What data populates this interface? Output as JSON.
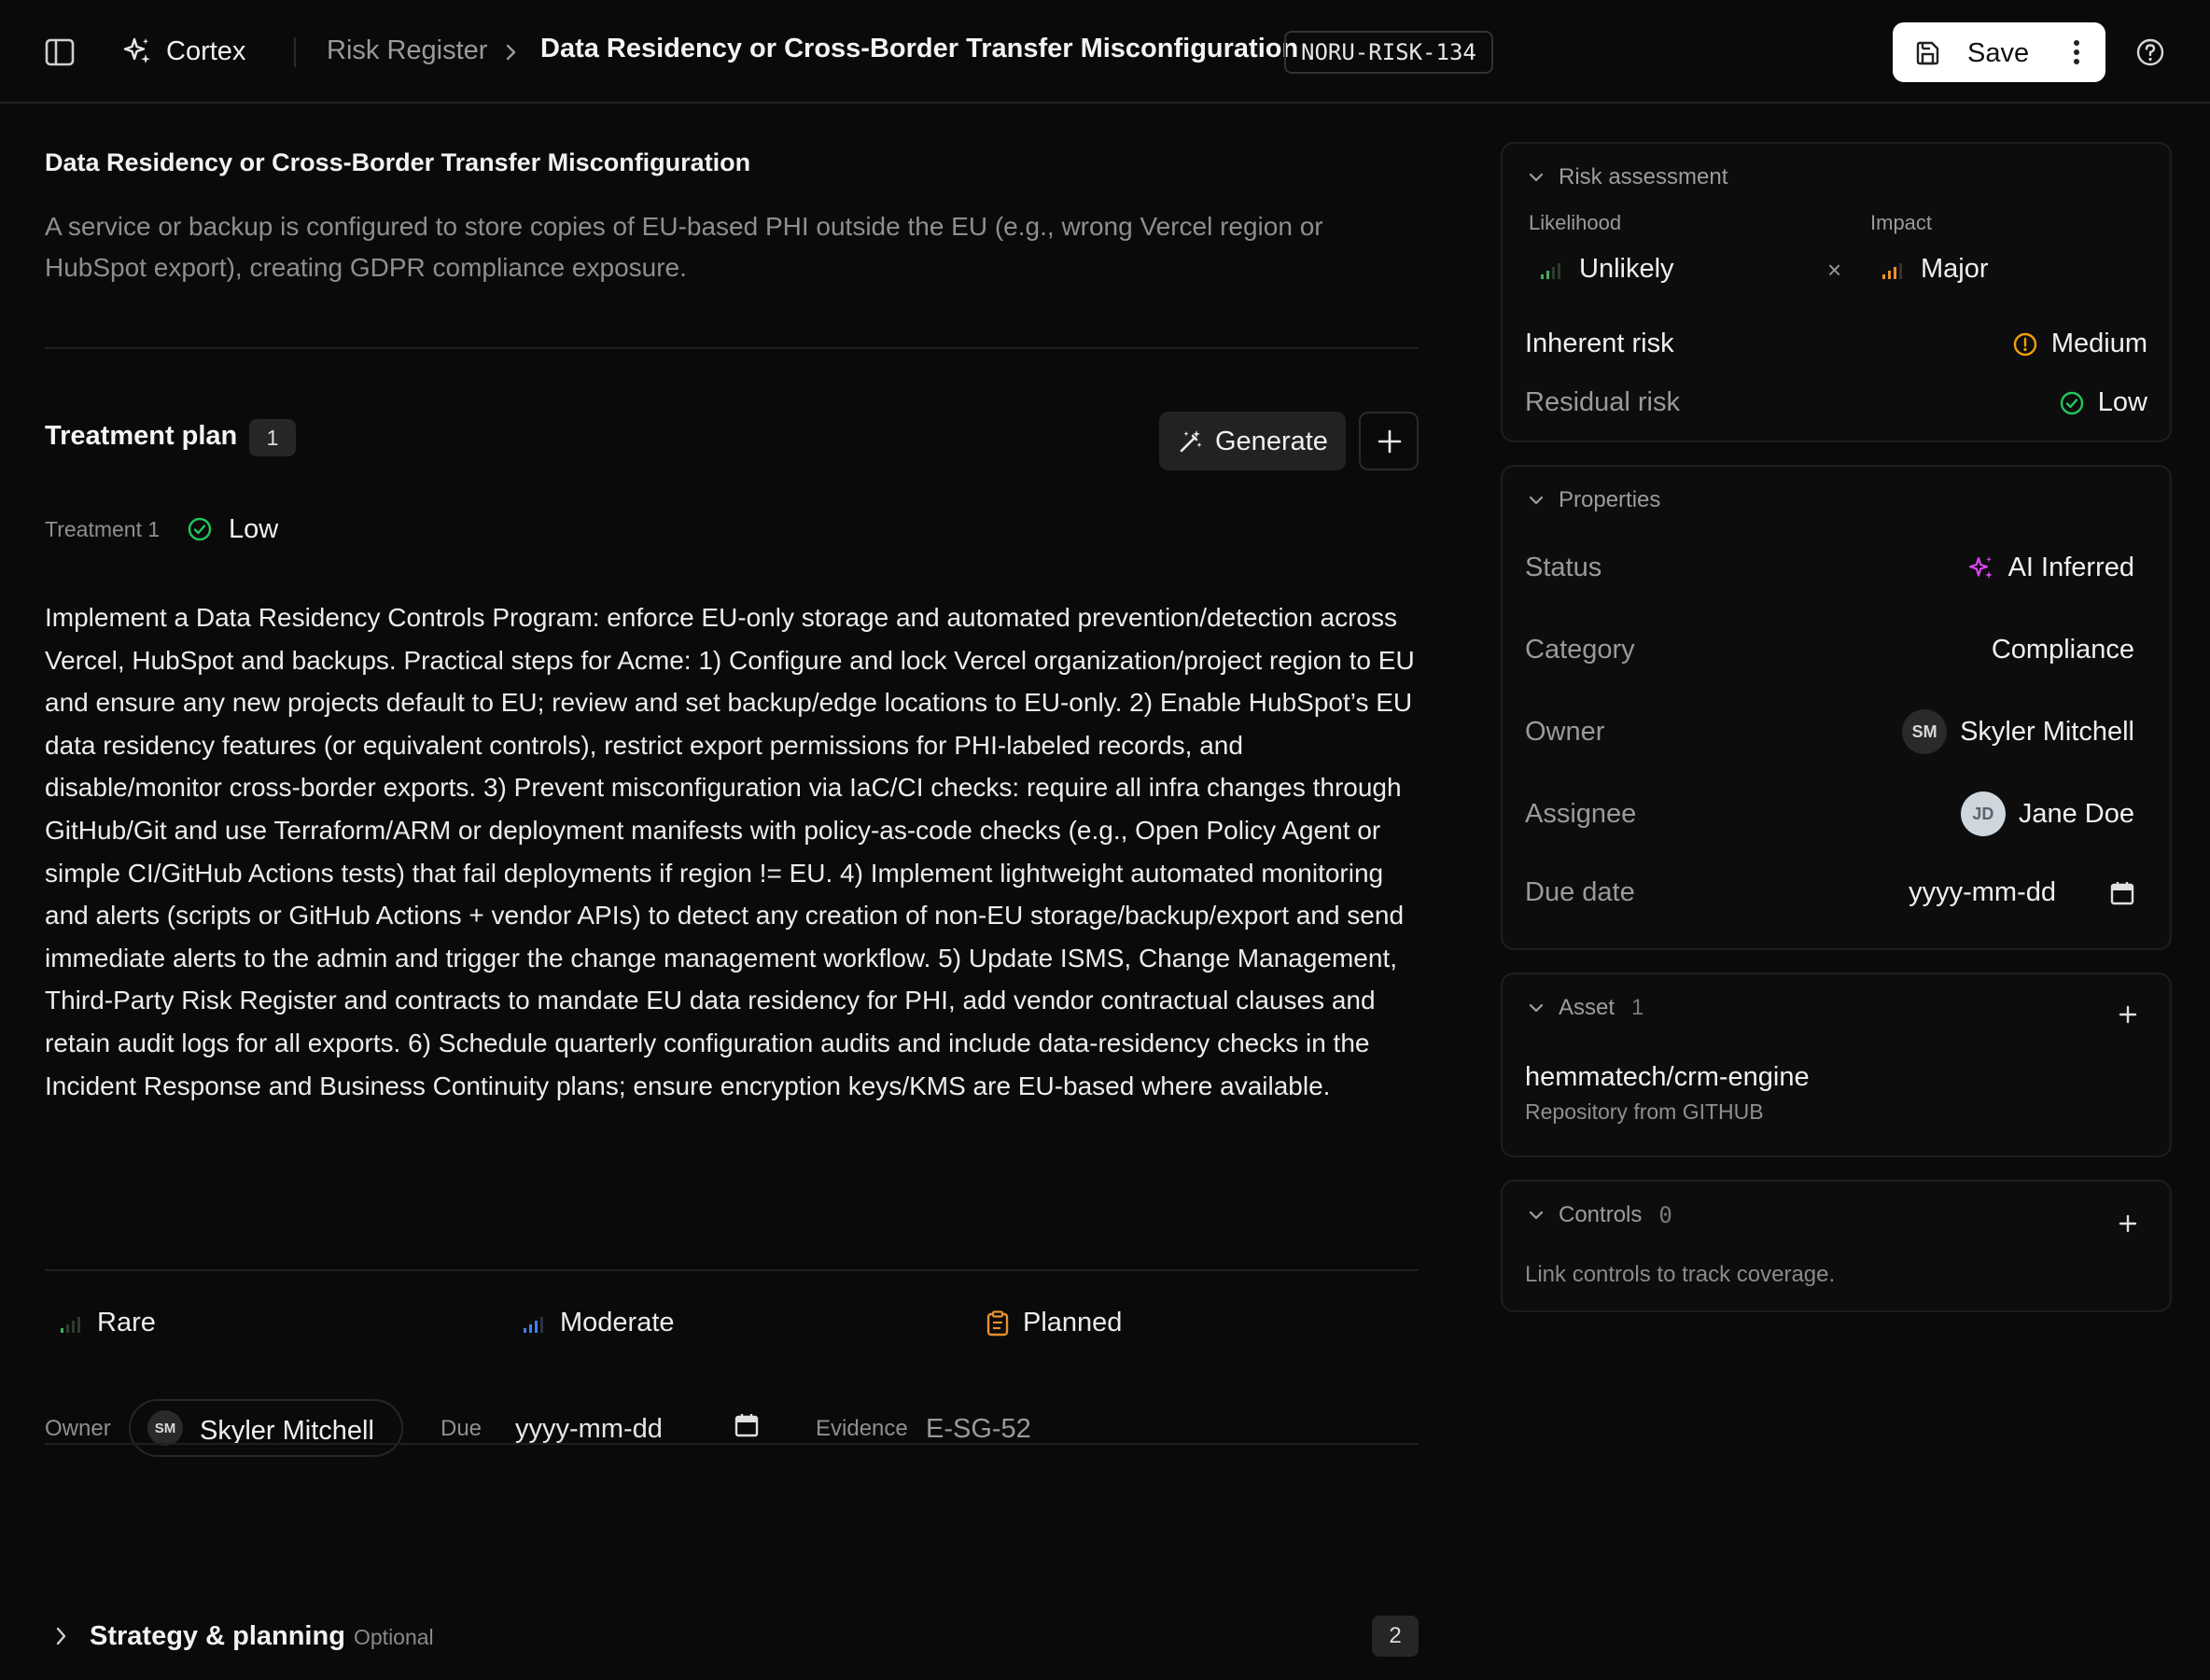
{
  "header": {
    "app_name": "Cortex",
    "breadcrumb_parent": "Risk Register",
    "breadcrumb_current": "Data Residency or Cross-Border Transfer Misconfiguration",
    "risk_id": "NORU-RISK-134",
    "save_label": "Save"
  },
  "risk": {
    "title": "Data Residency or Cross-Border Transfer Misconfiguration",
    "description": "A service or backup is configured to store copies of EU-based PHI outside the EU (e.g., wrong Vercel region or HubSpot export), creating GDPR compliance exposure."
  },
  "treatment_plan": {
    "title": "Treatment plan",
    "count": "1",
    "generate_label": "Generate",
    "treatment": {
      "label": "Treatment 1",
      "level": "Low",
      "text": "Implement a Data Residency Controls Program: enforce EU-only storage and automated prevention/detection across Vercel, HubSpot and backups. Practical steps for Acme: 1) Configure and lock Vercel organization/project region to EU and ensure any new projects default to EU; review and set backup/edge locations to EU-only. 2) Enable HubSpot’s EU data residency features (or equivalent controls), restrict export permissions for PHI-labeled records, and disable/monitor cross-border exports. 3) Prevent misconfiguration via IaC/CI checks: require all infra changes through GitHub/Git and use Terraform/ARM or deployment manifests with policy-as-code checks (e.g., Open Policy Agent or simple CI/GitHub Actions tests) that fail deployments if region != EU. 4) Implement lightweight automated monitoring and alerts (scripts or GitHub Actions + vendor APIs) to detect any creation of non-EU storage/backup/export and send immediate alerts to the admin and trigger the change management workflow. 5) Update ISMS, Change Management, Third-Party Risk Register and contracts to mandate EU data residency for PHI, add vendor contractual clauses and retain audit logs for all exports. 6) Schedule quarterly configuration audits and include data-residency checks in the Incident Response and Business Continuity plans; ensure encryption keys/KMS are EU-based where available.",
      "likelihood": "Rare",
      "impact": "Moderate",
      "status": "Planned",
      "owner_label": "Owner",
      "owner_initials": "SM",
      "owner_name": "Skyler Mitchell",
      "due_label": "Due",
      "due_placeholder": "yyyy-mm-dd",
      "evidence_label": "Evidence",
      "evidence_value": "E-SG-52"
    }
  },
  "strategy": {
    "title": "Strategy & planning",
    "optional_label": "Optional",
    "count": "2"
  },
  "risk_assessment": {
    "title": "Risk assessment",
    "likelihood_label": "Likelihood",
    "likelihood_value": "Unlikely",
    "impact_label": "Impact",
    "impact_value": "Major",
    "inherent_label": "Inherent risk",
    "inherent_value": "Medium",
    "residual_label": "Residual risk",
    "residual_value": "Low"
  },
  "properties": {
    "title": "Properties",
    "status_label": "Status",
    "status_value": "AI Inferred",
    "category_label": "Category",
    "category_value": "Compliance",
    "owner_label": "Owner",
    "owner_initials": "SM",
    "owner_name": "Skyler Mitchell",
    "assignee_label": "Assignee",
    "assignee_initials": "JD",
    "assignee_name": "Jane Doe",
    "due_label": "Due date",
    "due_placeholder": "yyyy-mm-dd"
  },
  "asset": {
    "title": "Asset",
    "count": "1",
    "name": "hemmatech/crm-engine",
    "subtitle": "Repository from GITHUB"
  },
  "controls": {
    "title": "Controls",
    "count": "0",
    "hint": "Link controls to track coverage."
  },
  "colors": {
    "background": "#0a0a0a",
    "likelihood_green": "#3fae5a",
    "impact_orange": "#e8912d",
    "moderate_blue": "#3b82f6",
    "warning_orange": "#f59e0b",
    "ok_green": "#22c55e",
    "ai_magenta": "#d946ef"
  }
}
